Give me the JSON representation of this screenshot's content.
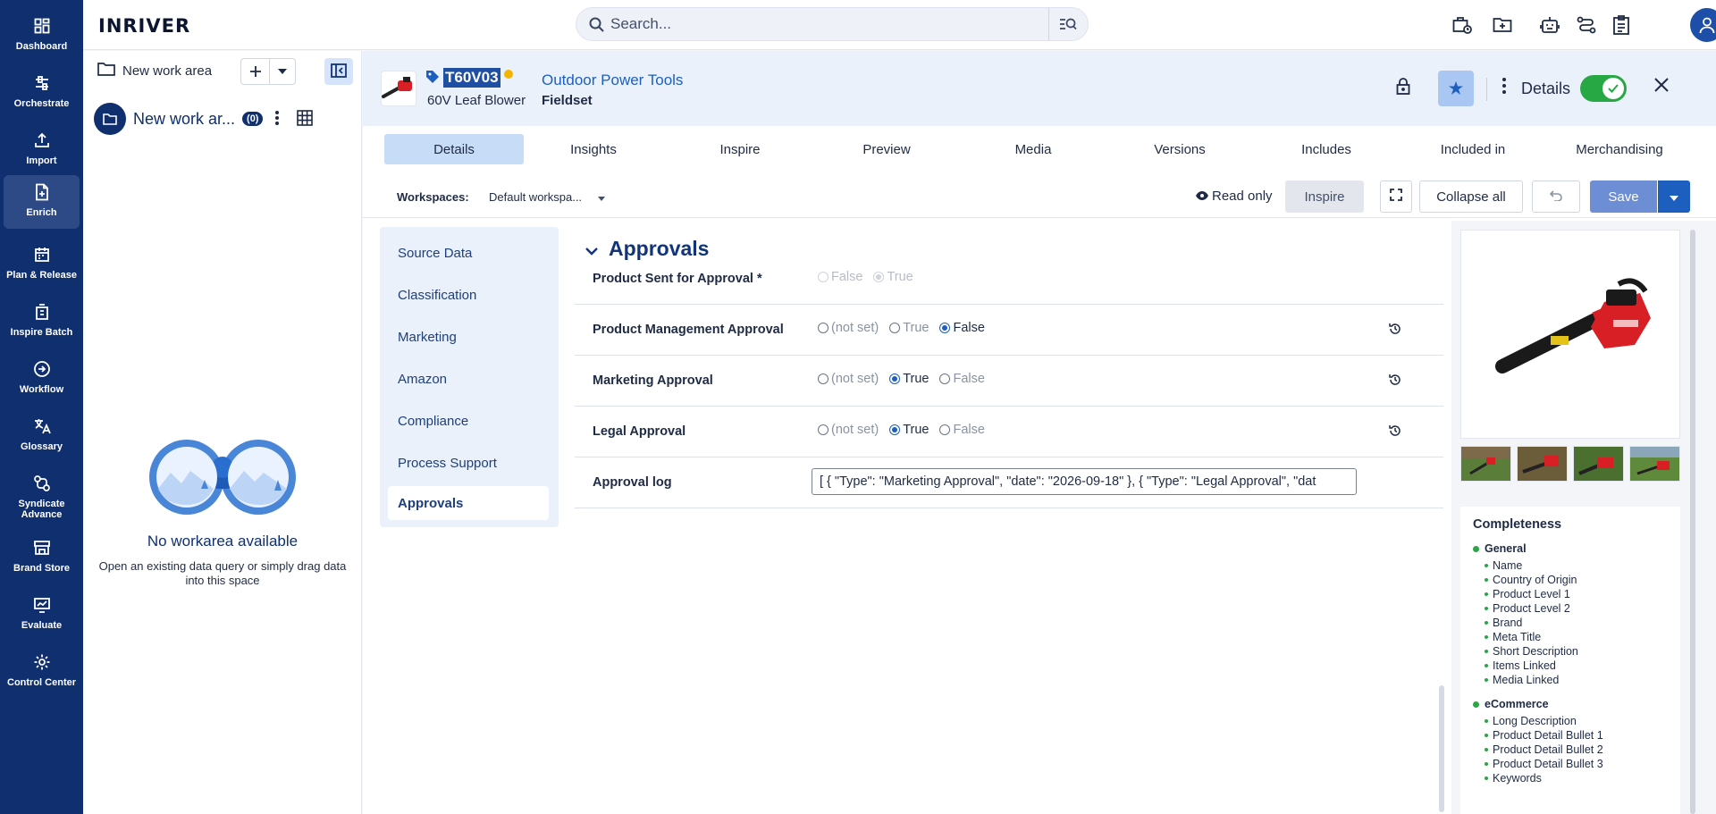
{
  "nav": [
    {
      "label": "Dashboard",
      "icon": "dashboard-icon"
    },
    {
      "label": "Orchestrate",
      "icon": "orchestrate-icon"
    },
    {
      "label": "Import",
      "icon": "import-icon"
    },
    {
      "label": "Enrich",
      "icon": "enrich-icon",
      "active": true
    },
    {
      "label": "Plan & Release",
      "icon": "calendar-icon"
    },
    {
      "label": "Inspire Batch",
      "icon": "inspire-batch-icon"
    },
    {
      "label": "Workflow",
      "icon": "workflow-icon"
    },
    {
      "label": "Glossary",
      "icon": "translate-icon"
    },
    {
      "label": "Syndicate Advance",
      "icon": "syndicate-icon"
    },
    {
      "label": "Brand Store",
      "icon": "store-icon"
    },
    {
      "label": "Evaluate",
      "icon": "evaluate-icon"
    },
    {
      "label": "Control Center",
      "icon": "gear-icon"
    }
  ],
  "topbar": {
    "logo": "INRIVER",
    "search_placeholder": "Search..."
  },
  "workspace": {
    "new_area_label": "New work area",
    "item_name": "New work ar...",
    "item_count": "(0)",
    "empty_title": "No workarea available",
    "empty_subtitle": "Open an existing data query or simply drag data into this space"
  },
  "entity": {
    "code": "T60V03",
    "name": "60V Leaf Blower",
    "type": "Outdoor Power Tools",
    "fieldset": "Fieldset",
    "details_label": "Details"
  },
  "tabs": [
    "Details",
    "Insights",
    "Inspire",
    "Preview",
    "Media",
    "Versions",
    "Includes",
    "Included in",
    "Merchandising"
  ],
  "toolbar": {
    "workspaces_label": "Workspaces:",
    "workspace_value": "Default workspa...",
    "read_only": "Read only",
    "inspire": "Inspire",
    "collapse_all": "Collapse all",
    "save": "Save"
  },
  "sections": [
    "Source Data",
    "Classification",
    "Marketing",
    "Amazon",
    "Compliance",
    "Process Support",
    "Approvals"
  ],
  "approvals": {
    "title": "Approvals",
    "fields": [
      {
        "label": "Product Sent for Approval *",
        "options": [
          "False",
          "True"
        ],
        "selected": "True",
        "disabled": true
      },
      {
        "label": "Product Management Approval",
        "options": [
          "(not set)",
          "True",
          "False"
        ],
        "selected": "False",
        "disabled": false
      },
      {
        "label": "Marketing Approval",
        "options": [
          "(not set)",
          "True",
          "False"
        ],
        "selected": "True",
        "disabled": false
      },
      {
        "label": "Legal Approval",
        "options": [
          "(not set)",
          "True",
          "False"
        ],
        "selected": "True",
        "disabled": false
      }
    ],
    "log_label": "Approval log",
    "log_value": "[ { \"Type\": \"Marketing Approval\", \"date\": \"2026-09-18\" }, { \"Type\": \"Legal Approval\", \"dat"
  },
  "completeness": {
    "title": "Completeness",
    "groups": [
      {
        "name": "General",
        "items": [
          "Name",
          "Country of Origin",
          "Product Level 1",
          "Product Level 2",
          "Brand",
          "Meta Title",
          "Short Description",
          "Items Linked",
          "Media Linked"
        ]
      },
      {
        "name": "eCommerce",
        "items": [
          "Long Description",
          "Product Detail Bullet 1",
          "Product Detail Bullet 2",
          "Product Detail Bullet 3",
          "Keywords"
        ]
      }
    ]
  },
  "colors": {
    "nav_bg": "#0f2f6f",
    "accent": "#1d5fbf",
    "success": "#28a745",
    "annotation_arrow": "#e53935"
  }
}
